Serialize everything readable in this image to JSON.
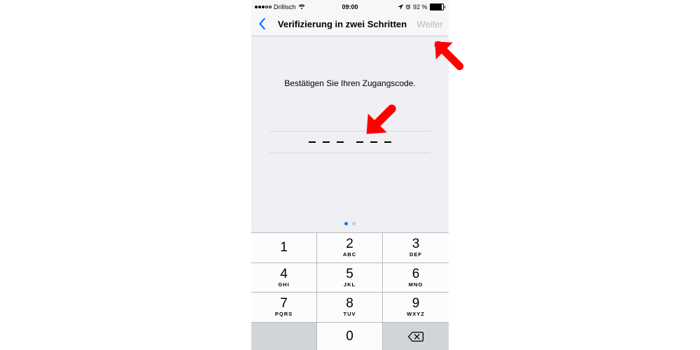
{
  "status_bar": {
    "carrier": "Drillisch",
    "time": "09:00",
    "battery_text": "92 %",
    "battery_fill_percent": 92,
    "signal_filled_dots": 3,
    "signal_total_dots": 5
  },
  "nav": {
    "title": "Verifizierung in zwei Schritten",
    "next_label": "Weiter"
  },
  "content": {
    "instruction": "Bestätigen Sie Ihren Zugangscode.",
    "code_digits_entered": 0,
    "code_length": 6
  },
  "pager": {
    "current": 1,
    "total": 2
  },
  "keypad": {
    "keys": [
      {
        "digit": "1",
        "letters": ""
      },
      {
        "digit": "2",
        "letters": "ABC"
      },
      {
        "digit": "3",
        "letters": "DEF"
      },
      {
        "digit": "4",
        "letters": "GHI"
      },
      {
        "digit": "5",
        "letters": "JKL"
      },
      {
        "digit": "6",
        "letters": "MNO"
      },
      {
        "digit": "7",
        "letters": "PQRS"
      },
      {
        "digit": "8",
        "letters": "TUV"
      },
      {
        "digit": "9",
        "letters": "WXYZ"
      },
      {
        "digit": "0",
        "letters": ""
      }
    ]
  },
  "annotations": {
    "arrow_color": "#ff0000"
  }
}
